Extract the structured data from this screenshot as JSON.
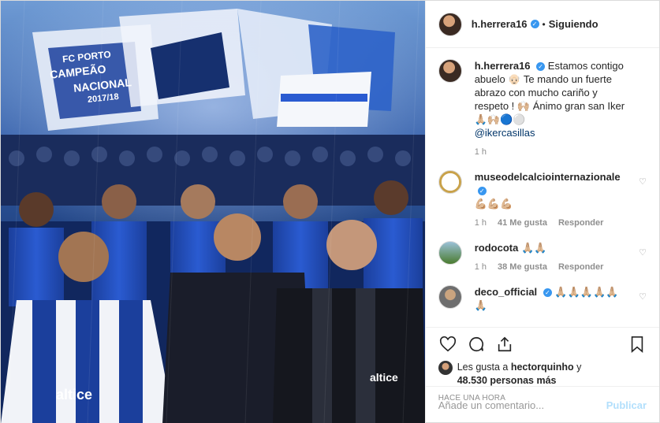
{
  "post": {
    "author": "h.herrera16",
    "follow_status": "Siguiendo",
    "image": {
      "banner_lines": [
        "FC PORTO",
        "CAMPEÃO",
        "NACIONAL",
        "2017/18"
      ],
      "jersey_sponsor": "altice"
    }
  },
  "caption": {
    "username": "h.herrera16",
    "text": "Estamos contigo abuelo 👴🏻 Te mando un fuerte abrazo con mucho cariño y respeto ! 🙌🏼 Ánimo gran san Iker 🙏🏼🙌🏼🔵⚪",
    "mention": "@ikercasillas",
    "time": "1 h"
  },
  "comments": [
    {
      "username": "museodelcalciointernazionale",
      "verified": true,
      "text": "💪🏼💪🏼💪🏼",
      "time": "1 h",
      "likes": "41 Me gusta",
      "reply": "Responder"
    },
    {
      "username": "rodocota",
      "verified": false,
      "text": "🙏🏼🙏🏼",
      "time": "1 h",
      "likes": "38 Me gusta",
      "reply": "Responder"
    },
    {
      "username": "deco_official",
      "verified": true,
      "text": "🙏🏼🙏🏼🙏🏼🙏🏼🙏🏼🙏🏼",
      "time": "",
      "likes": "",
      "reply": ""
    }
  ],
  "likes": {
    "prefix": "Les gusta a",
    "user": "hectorquinho",
    "joiner": "y",
    "count_text": "48.530 personas más"
  },
  "timestamp": "HACE UNA HORA",
  "add_comment": {
    "placeholder": "Añade un comentario...",
    "publish": "Publicar"
  },
  "icons": {
    "verified": "verified-badge-icon",
    "like": "heart-icon",
    "comment": "comment-bubble-icon",
    "share": "share-icon",
    "save": "bookmark-icon",
    "comment_like": "small-heart-icon"
  },
  "colors": {
    "porto_blue": "#1b3f9c",
    "verified": "#3897f0",
    "mention": "#003569",
    "publish_disabled": "#b2dffc"
  }
}
